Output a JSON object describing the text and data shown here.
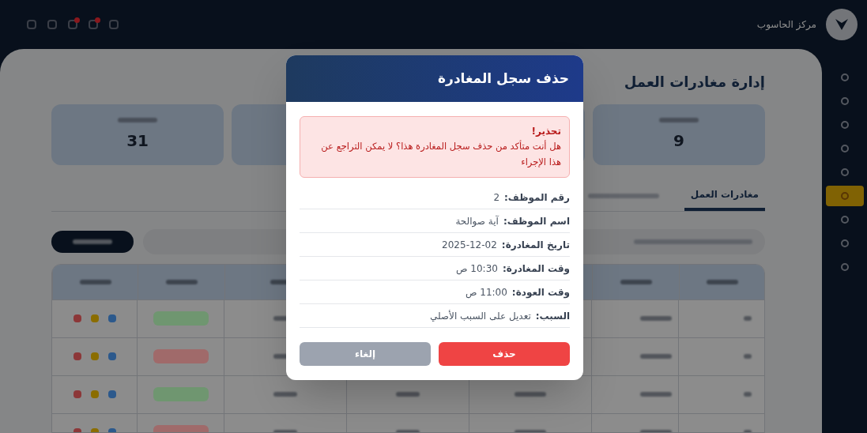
{
  "header": {
    "org_name": "مركز الحاسوب",
    "toolbar": [
      {
        "badge": false
      },
      {
        "badge": false
      },
      {
        "badge": true
      },
      {
        "badge": true
      },
      {
        "badge": false
      }
    ]
  },
  "sidebar": {
    "items": [
      {
        "selected": false
      },
      {
        "selected": false
      },
      {
        "selected": false
      },
      {
        "selected": false
      },
      {
        "selected": false
      },
      {
        "selected": true
      },
      {
        "selected": false
      },
      {
        "selected": false
      },
      {
        "selected": false
      }
    ]
  },
  "page": {
    "title": "إدارة مغادرات العمل"
  },
  "stat_cards": [
    {
      "value": "9"
    },
    {
      "value": "31"
    }
  ],
  "tabs": [
    {
      "label": "مغادرات العمل",
      "selected": true
    }
  ],
  "table": {
    "rows": [
      {
        "color": "#6f9670"
      },
      {
        "color": "#a06a6a"
      },
      {
        "color": "#6f9670"
      },
      {
        "color": "#a06a6a"
      }
    ]
  },
  "dialog": {
    "title": "حذف سجل المغادرة",
    "warning": {
      "title": "تحذير!",
      "message": "هل أنت متأكد من حذف سجل المغادرة هذا؟ لا يمكن التراجع عن هذا الإجراء"
    },
    "details": [
      {
        "label": "رقم الموظف:",
        "value": "2"
      },
      {
        "label": "اسم الموظف:",
        "value": "آية صوالحة"
      },
      {
        "label": "تاريخ المغادرة:",
        "value": "2025-12-02"
      },
      {
        "label": "وقت المغادرة:",
        "value": "10:30 ص"
      },
      {
        "label": "وقت العودة:",
        "value": "11:00 ص"
      },
      {
        "label": "السبب:",
        "value": "تعديل على السبب الأصلي"
      }
    ],
    "buttons": [
      {
        "label": "حذف",
        "kind": "danger"
      },
      {
        "label": "إلغاء",
        "kind": "secondary"
      }
    ]
  }
}
